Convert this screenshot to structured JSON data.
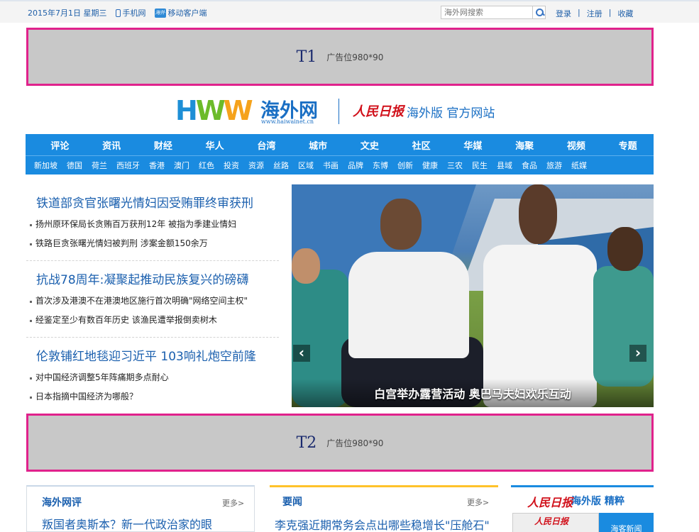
{
  "topbar": {
    "date": "2015年7月1日 星期三",
    "mobile": "手机网",
    "app_icon": "海外",
    "app": "移动客户端",
    "search_placeholder": "海外网搜索",
    "login": "登录",
    "register": "注册",
    "favorite": "收藏",
    "sep": "|"
  },
  "ads": [
    {
      "code": "T1",
      "size": "广告位980*90"
    },
    {
      "code": "T2",
      "size": "广告位980*90"
    }
  ],
  "logo": {
    "h": "H",
    "w1": "W",
    "w2": "W",
    "name": "海外网",
    "url": "www.haiwainet.cn",
    "peoples_daily": "人民日报",
    "overseas": "海外版 官方网站"
  },
  "nav_main": [
    "评论",
    "资讯",
    "财经",
    "华人",
    "台湾",
    "城市",
    "文史",
    "社区",
    "华媒",
    "海聚",
    "视频",
    "专题"
  ],
  "nav_sub": [
    "新加坡",
    "德国",
    "荷兰",
    "西班牙",
    "香港",
    "澳门",
    "红色",
    "投资",
    "资源",
    "丝路",
    "区域",
    "书画",
    "品牌",
    "东博",
    "创新",
    "健康",
    "三农",
    "民生",
    "县域",
    "食品",
    "旅游",
    "纸媒"
  ],
  "news": [
    {
      "headline": "铁道部贪官张曙光情妇因受贿罪终审获刑",
      "subs": [
        "扬州原环保局长贪贿百万获刑12年  被指为季建业情妇",
        "铁路巨贪张曙光情妇被判刑  涉案金额150余万"
      ]
    },
    {
      "headline": "抗战78周年:凝聚起推动民族复兴的磅礴",
      "subs": [
        "首次涉及港澳不在港澳地区施行首次明确\"网络空间主权\"",
        "经鉴定至少有数百年历史  该渔民遭举报倒卖树木"
      ]
    },
    {
      "headline": "伦敦铺红地毯迎习近平 103响礼炮空前隆",
      "subs": [
        "对中国经济调整5年阵痛期多点耐心",
        "日本指摘中国经济为哪般？"
      ]
    }
  ],
  "slider": {
    "caption": "白宫举办露营活动 奥巴马夫妇欢乐互动",
    "prev": "‹",
    "next": "›"
  },
  "columns": {
    "review": {
      "title": "海外网评",
      "more": "更多>",
      "text": "叛国者奥斯本？新一代政治家的眼"
    },
    "news": {
      "title": "要闻",
      "more": "更多>",
      "text": "李克强近期常务会点出哪些稳增长\"压舱石\""
    },
    "paper": {
      "peoples_daily": "人民日报",
      "title": "海外版 精粹",
      "thumb": "人民日报",
      "button": "海客新闻"
    }
  }
}
